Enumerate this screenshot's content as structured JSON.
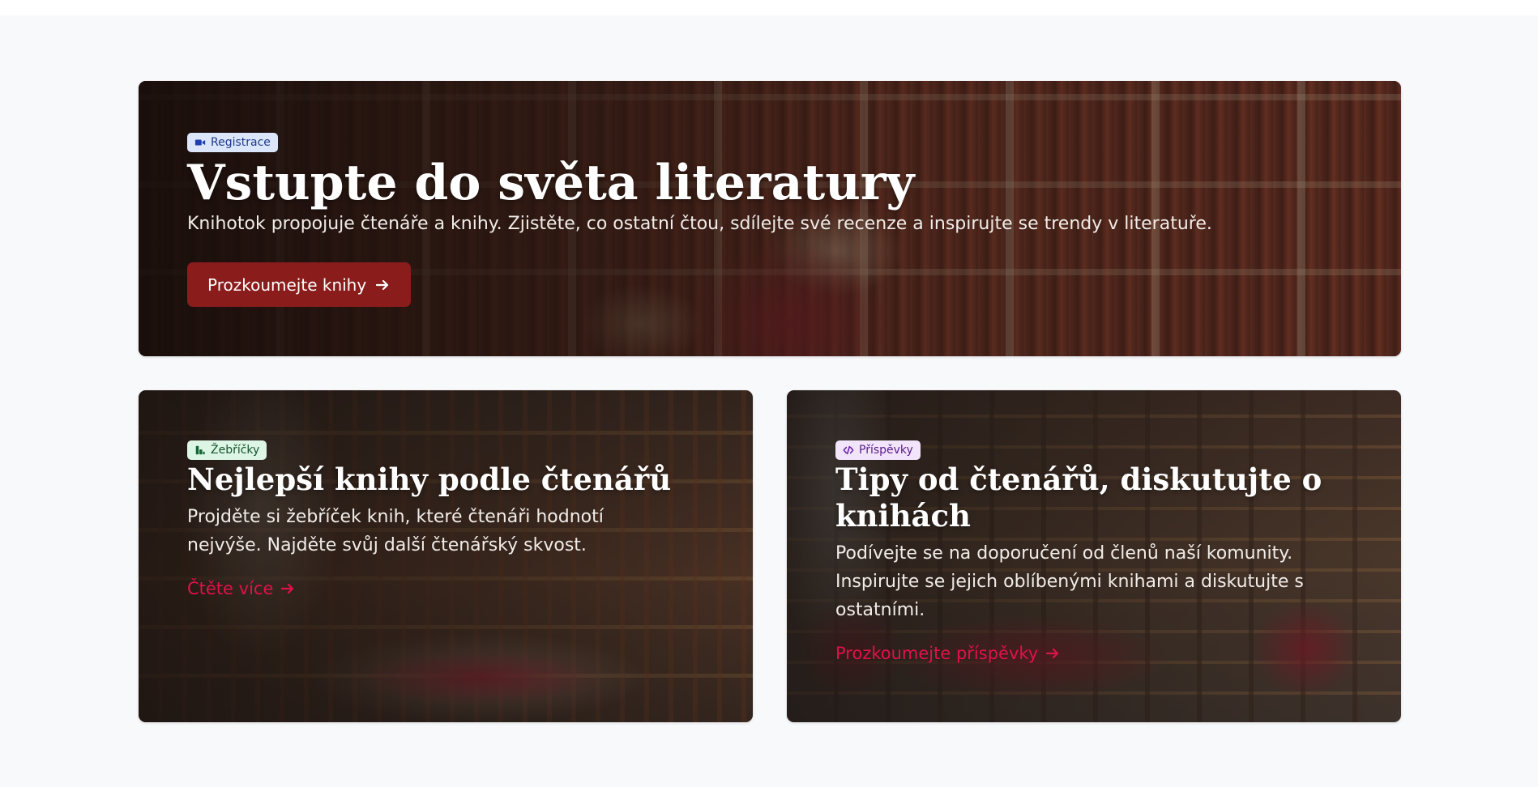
{
  "colors": {
    "page_background": "#f8f9fb",
    "primary_button": "#8a1c1c",
    "link_accent": "#e0124a"
  },
  "hero": {
    "badge_label": "Registrace",
    "badge_icon": "video-icon",
    "title": "Vstupte do světa literatury",
    "description": "Knihotok propojuje čtenáře a knihy. Zjistěte, co ostatní čtou, sdílejte své recenze a inspirujte se trendy v literatuře.",
    "button_label": "Prozkoumejte knihy",
    "button_icon": "arrow-right-icon"
  },
  "cards": [
    {
      "badge_label": "Žebříčky",
      "badge_icon": "chart-icon",
      "title": "Nejlepší knihy podle čtenářů",
      "description": "Projděte si žebříček knih, které čtenáři hodnotí nejvýše. Najděte svůj další čtenářský skvost.",
      "link_label": "Čtěte více",
      "link_icon": "arrow-right-icon"
    },
    {
      "badge_label": "Příspěvky",
      "badge_icon": "code-icon",
      "title": "Tipy od čtenářů, diskutujte o knihách",
      "description": "Podívejte se na doporučení od členů naší komunity. Inspirujte se jejich oblíbenými knihami a diskutujte s ostatními.",
      "link_label": "Prozkoumejte příspěvky",
      "link_icon": "arrow-right-icon"
    }
  ]
}
